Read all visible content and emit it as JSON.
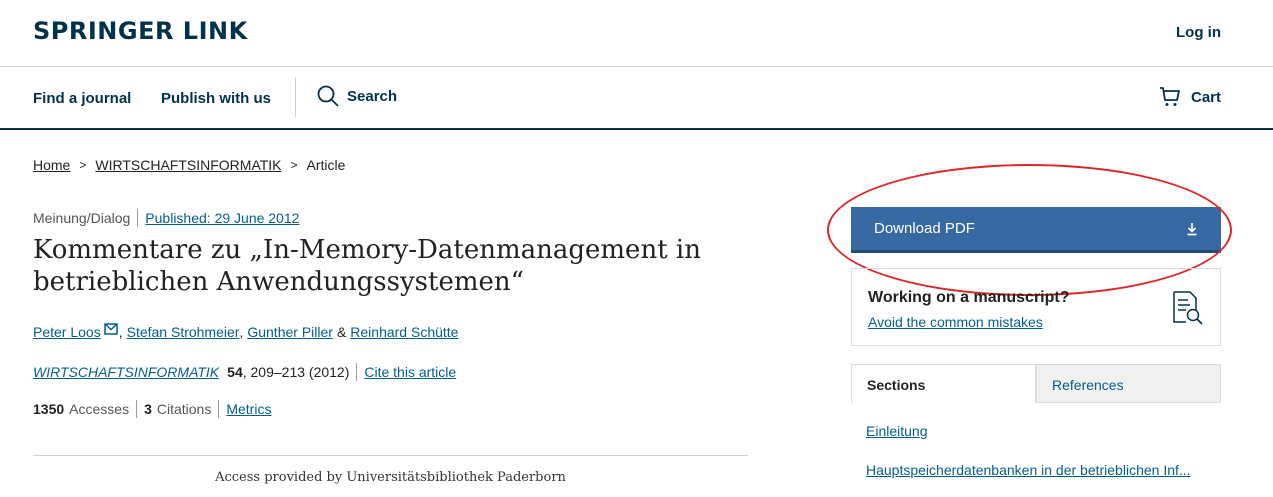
{
  "header": {
    "logo": "SPRINGER LINK",
    "login": "Log in"
  },
  "nav": {
    "find_journal": "Find a journal",
    "publish": "Publish with us",
    "search": "Search",
    "cart": "Cart"
  },
  "breadcrumb": {
    "items": [
      "Home",
      "WIRTSCHAFTSINFORMATIK",
      "Article"
    ],
    "separator": ">"
  },
  "article": {
    "type": "Meinung/Dialog",
    "published": "Published: 29 June 2012",
    "title": "Kommentare zu „In-Memory-Datenmanagement in betrieblichen Anwendungssystemen“",
    "authors": [
      "Peter Loos",
      "Stefan Strohmeier",
      "Gunther Piller",
      "Reinhard Schütte"
    ],
    "author_comma": ",",
    "author_amp": "&",
    "journal": "WIRTSCHAFTSINFORMATIK",
    "volume": "54",
    "pages_year": ", 209–213 (2012)",
    "cite": "Cite this article",
    "accesses_count": "1350",
    "accesses_label": "Accesses",
    "citations_count": "3",
    "citations_label": "Citations",
    "metrics": "Metrics",
    "access_provided": "Access provided by Universitätsbibliothek Paderborn"
  },
  "sidebar": {
    "download": "Download PDF",
    "manuscript_title": "Working on a manuscript?",
    "manuscript_link": "Avoid the common mistakes",
    "tabs": [
      "Sections",
      "References"
    ],
    "sections": [
      "Einleitung",
      "Hauptspeicherdatenbanken in der betrieblichen Inf..."
    ]
  },
  "colors": {
    "brand": "#01324b",
    "link": "#025e8d",
    "button": "#3669a1",
    "annotation": "#e02424"
  },
  "icons": [
    "search-icon",
    "cart-icon",
    "envelope-icon",
    "download-icon",
    "document-search-icon",
    "chevron-right-icon"
  ]
}
